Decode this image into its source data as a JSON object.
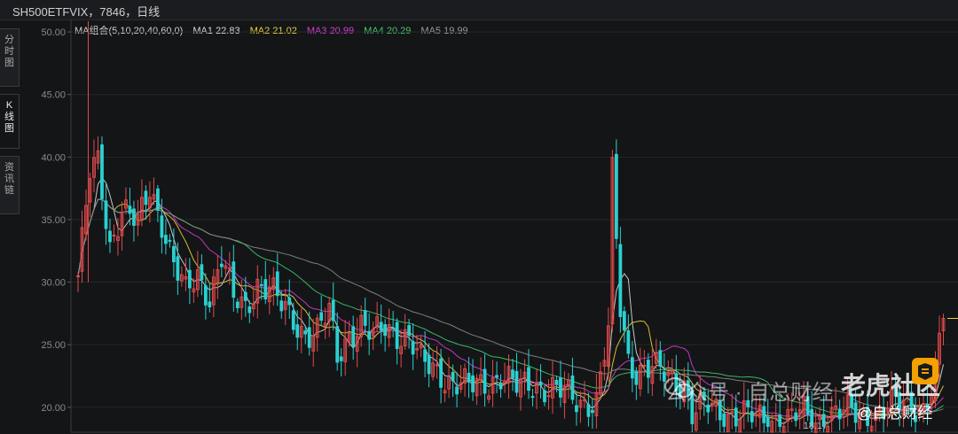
{
  "header": {
    "title": "SH500ETFVIX，7846，日线"
  },
  "side_tabs": [
    {
      "label": [
        "分",
        "时",
        "图"
      ],
      "active": false
    },
    {
      "label": [
        "K",
        "线",
        "图"
      ],
      "active": true
    },
    {
      "label": [
        "资",
        "讯",
        "链"
      ],
      "active": false
    }
  ],
  "legend": {
    "group": "MA组合(5,10,20,40,60,0)",
    "items": [
      {
        "text": "MA1 22.83",
        "color": "#d9d9d9"
      },
      {
        "text": "MA2 21.02",
        "color": "#e6d23a"
      },
      {
        "text": "MA3 20.99",
        "color": "#d63bd6"
      },
      {
        "text": "MA4 20.29",
        "color": "#3fc96a"
      },
      {
        "text": "MA5 19.99",
        "color": "#9a9a9a"
      }
    ]
  },
  "watermarks": {
    "brand": "老虎社区",
    "account": "公众号 · 自总财经",
    "handle": "@自总财经"
  },
  "chart_data": {
    "type": "candlestick",
    "ylim": [
      18,
      51
    ],
    "yticks": [
      "50.00",
      "45.00",
      "40.00",
      "35.00",
      "30.00",
      "25.00",
      "20.00"
    ],
    "ytick_values": [
      50,
      45,
      40,
      35,
      30,
      25,
      20
    ],
    "max_label": "50.86",
    "max_value": 50.86,
    "min_label": "18.17",
    "min_value": 18.17,
    "last_price": 27.1,
    "colors": {
      "up": "#e04b4b",
      "down": "#2ad1d1",
      "ma1": "#d9d9d9",
      "ma2": "#e6d23a",
      "ma3": "#d63bd6",
      "ma4": "#3fc96a",
      "ma5": "#8a8a8a"
    },
    "close_anchors": [
      [
        0,
        30.5
      ],
      [
        3,
        38.5
      ],
      [
        5,
        39.5
      ],
      [
        8,
        33.0
      ],
      [
        11,
        36.0
      ],
      [
        15,
        34.5
      ],
      [
        18,
        37.5
      ],
      [
        21,
        35.0
      ],
      [
        24,
        31.5
      ],
      [
        27,
        29.0
      ],
      [
        30,
        30.5
      ],
      [
        33,
        29.0
      ],
      [
        36,
        32.0
      ],
      [
        39,
        28.5
      ],
      [
        42,
        28.0
      ],
      [
        45,
        30.0
      ],
      [
        48,
        29.5
      ],
      [
        51,
        28.0
      ],
      [
        54,
        27.0
      ],
      [
        57,
        26.0
      ],
      [
        60,
        26.0
      ],
      [
        63,
        27.5
      ],
      [
        65,
        24.0
      ],
      [
        68,
        26.0
      ],
      [
        71,
        26.5
      ],
      [
        74,
        25.5
      ],
      [
        77,
        26.5
      ],
      [
        80,
        26.0
      ],
      [
        83,
        25.5
      ],
      [
        86,
        23.5
      ],
      [
        90,
        23.0
      ],
      [
        94,
        22.0
      ],
      [
        98,
        21.5
      ],
      [
        102,
        22.0
      ],
      [
        106,
        22.5
      ],
      [
        110,
        21.5
      ],
      [
        114,
        22.0
      ],
      [
        118,
        21.5
      ],
      [
        122,
        21.0
      ],
      [
        126,
        20.5
      ],
      [
        130,
        20.5
      ],
      [
        133,
        26.0
      ],
      [
        134,
        38.5
      ],
      [
        136,
        28.0
      ],
      [
        138,
        24.0
      ],
      [
        140,
        23.0
      ],
      [
        144,
        23.0
      ],
      [
        148,
        22.5
      ],
      [
        152,
        22.0
      ],
      [
        154,
        19.5
      ],
      [
        158,
        20.0
      ],
      [
        162,
        19.5
      ],
      [
        166,
        19.5
      ],
      [
        170,
        19.0
      ],
      [
        174,
        19.0
      ],
      [
        178,
        19.0
      ],
      [
        182,
        19.5
      ],
      [
        185,
        18.8
      ],
      [
        188,
        19.5
      ],
      [
        192,
        19.5
      ],
      [
        196,
        19.5
      ],
      [
        200,
        19.5
      ],
      [
        204,
        20.0
      ],
      [
        208,
        20.5
      ],
      [
        212,
        20.0
      ],
      [
        215,
        22.0
      ],
      [
        216,
        25.0
      ],
      [
        217,
        27.0
      ]
    ],
    "ma1_at_last": 22.83,
    "ma2_at_last": 21.02,
    "ma3_at_last": 20.99,
    "ma4_at_last": 20.29,
    "ma5_at_last": 19.99
  }
}
